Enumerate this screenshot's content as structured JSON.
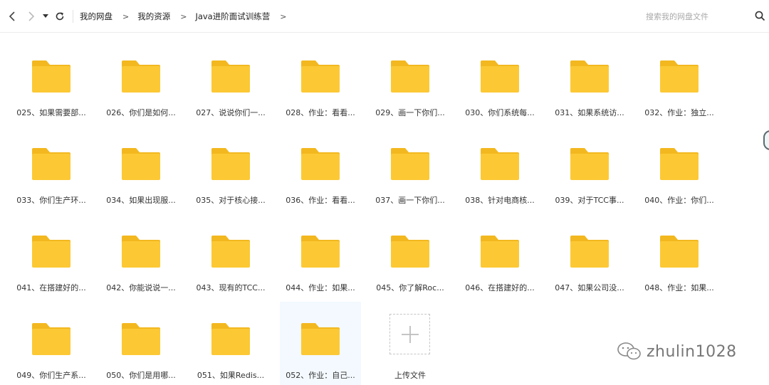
{
  "breadcrumb": {
    "items": [
      "我的网盘",
      "我的资源",
      "Java进阶面试训练营"
    ],
    "separator": ">"
  },
  "search": {
    "placeholder": "搜索我的网盘文件"
  },
  "folders": [
    "025、如果需要部...",
    "026、你们是如何...",
    "027、说说你们一...",
    "028、作业：看看...",
    "029、画一下你们...",
    "030、你们系统每...",
    "031、如果系统访...",
    "032、作业：独立...",
    "033、你们生产环...",
    "034、如果出现服...",
    "035、对于核心接...",
    "036、作业：看看...",
    "037、画一下你们...",
    "038、针对电商核...",
    "039、对于TCC事...",
    "040、作业：你们...",
    "041、在搭建好的...",
    "042、你能说说一...",
    "043、现有的TCC...",
    "044、作业：如果...",
    "045、你了解Roc...",
    "046、在搭建好的...",
    "047、如果公司没...",
    "048、作业：如果...",
    "049、你们生产系...",
    "050、你们是用哪...",
    "051、如果Redis...",
    "052、作业：自己..."
  ],
  "upload": {
    "label": "上传文件"
  },
  "watermark": {
    "text": "zhulin1028"
  },
  "colors": {
    "folder_body": "#fcc935",
    "folder_tab": "#f3b81f",
    "selected_bg": "#f3f9fe"
  }
}
